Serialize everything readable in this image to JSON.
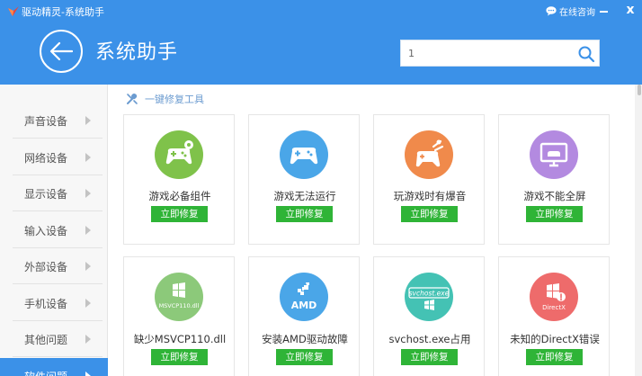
{
  "window": {
    "app_title": "驱动精灵-系统助手",
    "help_label": "在线咨询",
    "close_glyph": "x"
  },
  "header": {
    "page_title": "系统助手",
    "search_value": "1"
  },
  "sidebar": {
    "items": [
      {
        "label": "声音设备"
      },
      {
        "label": "网络设备"
      },
      {
        "label": "显示设备"
      },
      {
        "label": "输入设备"
      },
      {
        "label": "外部设备"
      },
      {
        "label": "手机设备"
      },
      {
        "label": "其他问题"
      },
      {
        "label": "软件问题",
        "active": true
      }
    ]
  },
  "main": {
    "section_title": "一键修复工具",
    "fix_label": "立即修复",
    "cards": [
      {
        "title": "游戏必备组件",
        "icon": "gamepad-settings-icon",
        "color": "#7fc24a"
      },
      {
        "title": "游戏无法运行",
        "icon": "gamepad-icon",
        "color": "#4aa6e8"
      },
      {
        "title": "玩游戏时有爆音",
        "icon": "gamepad-sound-icon",
        "color": "#f08a4b"
      },
      {
        "title": "游戏不能全屏",
        "icon": "monitor-gamepad-icon",
        "color": "#b38ae0"
      },
      {
        "title": "缺少MSVCP110.dll",
        "icon": "windows-dll-icon",
        "color": "#8cc97a",
        "badge": "MSVCP110.dll"
      },
      {
        "title": "安装AMD驱动故障",
        "icon": "amd-icon",
        "color": "#4aa6e8",
        "badge": "AMD"
      },
      {
        "title": "svchost.exe占用",
        "icon": "svchost-icon",
        "color": "#44c2b4",
        "badge": "svchost.exe"
      },
      {
        "title": "未知的DirectX错误",
        "icon": "directx-error-icon",
        "color": "#ee6b6b",
        "badge": "DirectX"
      }
    ]
  },
  "colors": {
    "header_blue": "#3b91e8",
    "fix_green": "#2fb437"
  }
}
